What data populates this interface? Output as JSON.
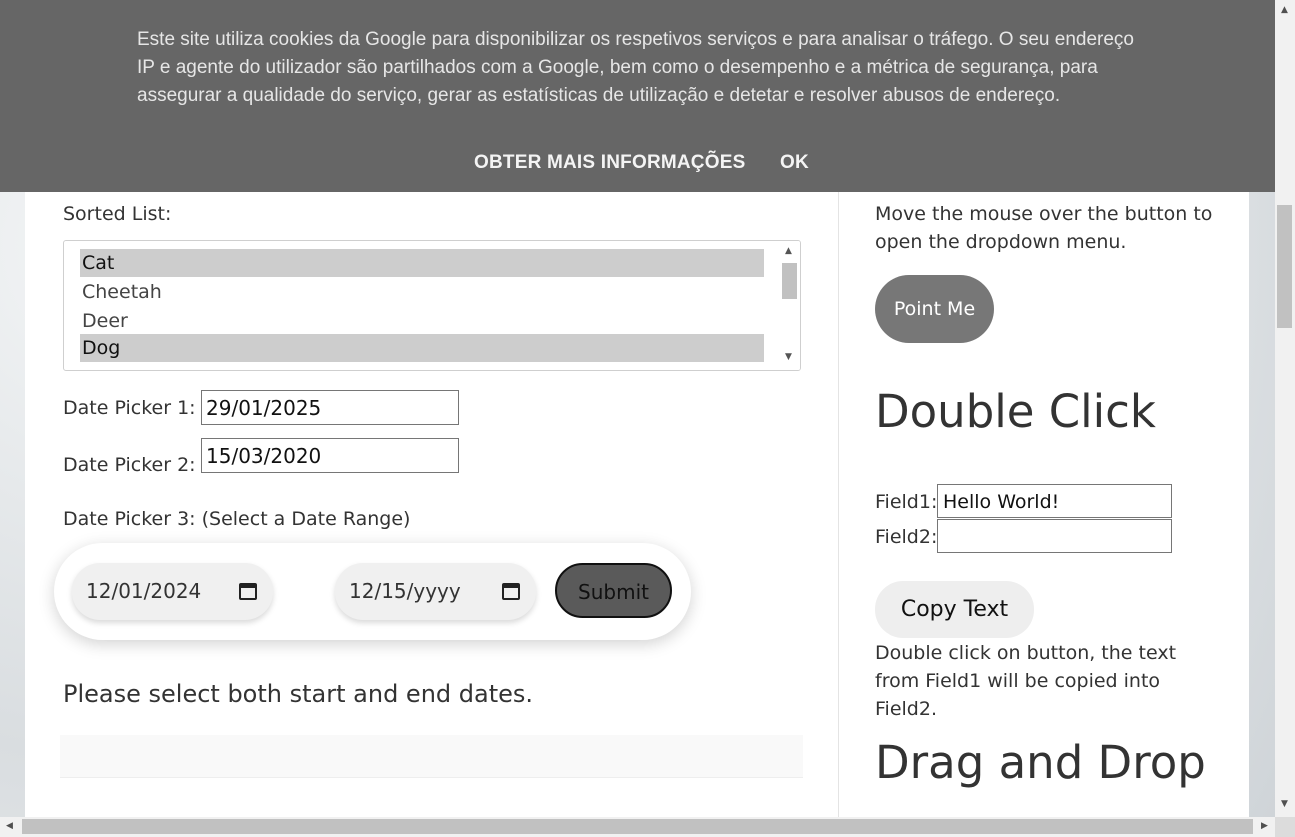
{
  "cookie": {
    "text": "Este site utiliza cookies da Google para disponibilizar os respetivos serviços e para analisar o tráfego. O seu endereço IP e agente do utilizador são partilhados com a Google, bem como o desempenho e a métrica de segurança, para assegurar a qualidade do serviço, gerar as estatísticas de utilização e detetar e resolver abusos de endereço.",
    "more_info": "OBTER MAIS INFORMAÇÕES",
    "ok": "OK"
  },
  "sorted_list": {
    "label": "Sorted List:",
    "items": [
      {
        "label": "Cat",
        "selected": true
      },
      {
        "label": "Cheetah",
        "selected": false
      },
      {
        "label": "Deer",
        "selected": false
      },
      {
        "label": "Dog",
        "selected": true
      }
    ]
  },
  "date_picker_1": {
    "label": "Date Picker 1:",
    "value": "29/01/2025"
  },
  "date_picker_2": {
    "label": "Date Picker 2:",
    "value": "15/03/2020"
  },
  "date_picker_3": {
    "label": "Date Picker 3: (Select a Date Range)",
    "start": "12/01/2024",
    "end": "12/15/yyyy",
    "submit": "Submit"
  },
  "message": "Please select both start and end dates.",
  "sidebar": {
    "hover_text": "Move the mouse over the button to open the dropdown menu.",
    "point_button": "Point Me",
    "double_click_title": "Double Click",
    "field1_label": "Field1:",
    "field1_value": "Hello World!",
    "field2_label": "Field2:",
    "field2_value": "",
    "copy_button": "Copy Text",
    "double_click_text": "Double click on button, the text from Field1 will be copied into Field2.",
    "drag_drop_title": "Drag and Drop"
  }
}
